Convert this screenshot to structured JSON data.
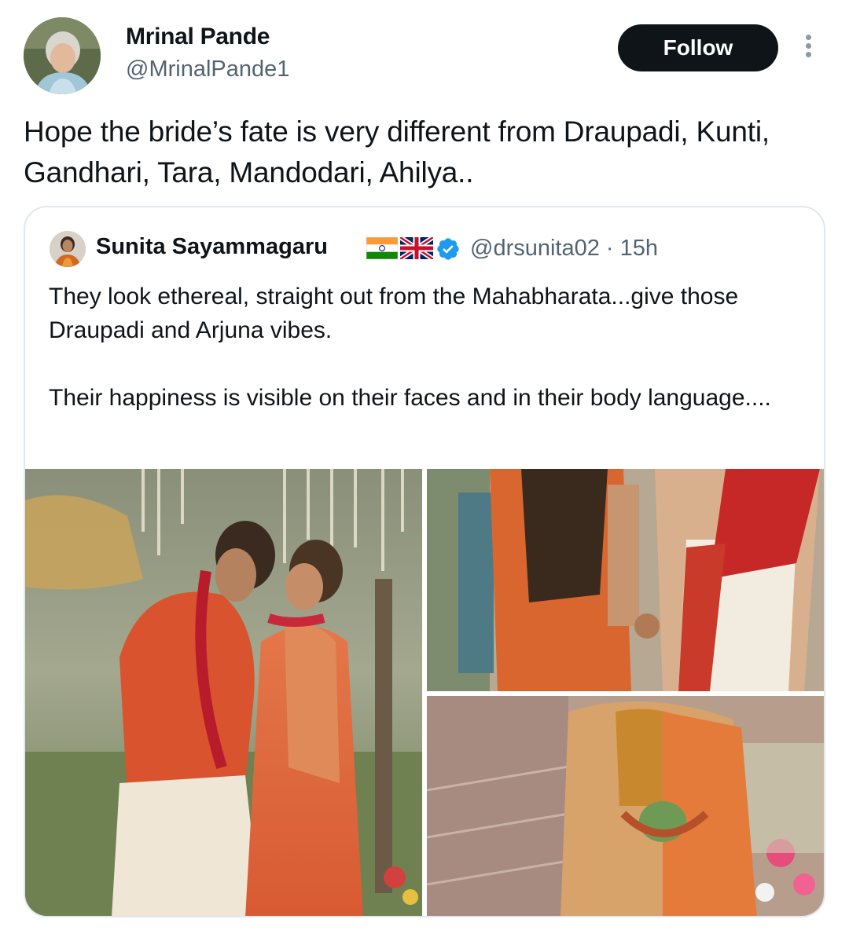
{
  "tweet": {
    "author_name": "Mrinal Pande",
    "author_handle": "@MrinalPande1",
    "follow_label": "Follow",
    "text": "Hope the bride’s fate is very different from Draupadi, Kunti, Gandhari, Tara, Mandodari, Ahilya.."
  },
  "quoted": {
    "author_name": "Sunita Sayammagaru",
    "flags": [
      "india-flag-icon",
      "uk-flag-icon"
    ],
    "verified": true,
    "handle_time": "@drsunita02 · 15h",
    "paragraph1": "They look ethereal, straight out from the Mahabharata...give those Draupadi and Arjuna vibes.",
    "paragraph2": "Their happiness is visible on their faces and in their body language...."
  },
  "colors": {
    "text": "#0f1419",
    "secondary": "#536471",
    "follow_bg": "#0f1419",
    "verified_blue": "#1d9bf0",
    "border": "#e1e8ed"
  }
}
